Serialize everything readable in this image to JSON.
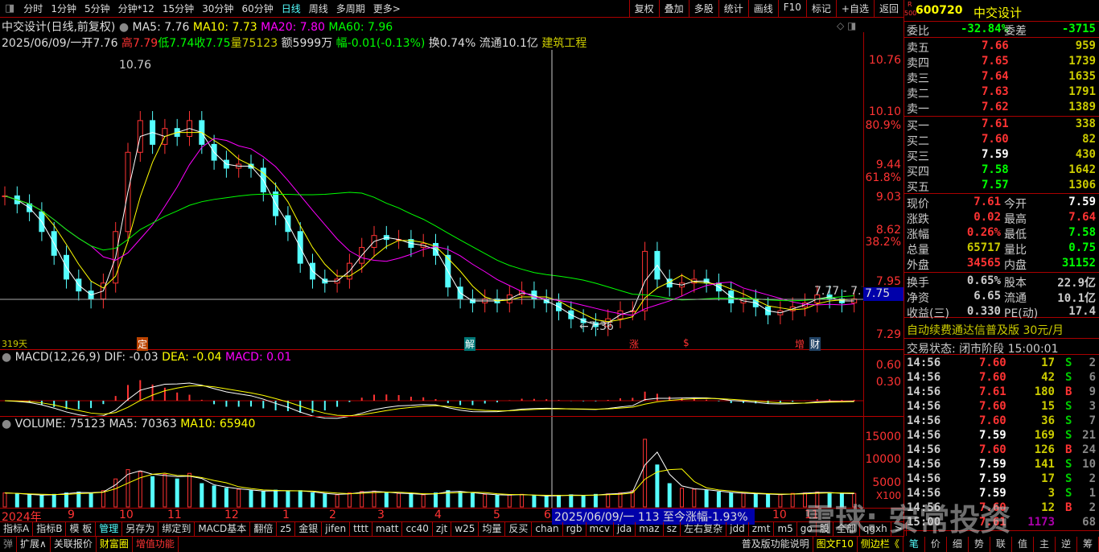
{
  "toolbar": {
    "periods": [
      "分时",
      "1分钟",
      "5分钟",
      "分钟*12",
      "15分钟",
      "30分钟",
      "60分钟",
      "日线",
      "周线",
      "多周期",
      "更多>"
    ],
    "active": "日线",
    "right": [
      "复权",
      "叠加",
      "多股",
      "统计",
      "画线",
      "F10",
      "标记",
      "+自选",
      "返回"
    ]
  },
  "header": {
    "title": "中交设计(日线,前复权)",
    "ma5": "MA5: 7.76",
    "ma10": "MA10: 7.73",
    "ma20": "MA20: 7.80",
    "ma60": "MA60: 7.96",
    "date": "2025/06/09/一",
    "open": "开7.76",
    "high": "高7.79",
    "low": "低7.74",
    "close": "收7.75",
    "vol": "量75123",
    "amt": "额5999万",
    "chg": "幅-0.01(-0.13%)",
    "turn": "换0.74%",
    "float": "流通10.1亿",
    "sector": "建筑工程"
  },
  "price_axis": [
    "10.76",
    "10.10",
    "80.9%",
    "9.44",
    "61.8%",
    "9.03",
    "8.62",
    "38.2%",
    "7.95",
    "7.29"
  ],
  "current_price_tag": "7.75",
  "annotations": {
    "high": "10.76",
    "low": "←7.36",
    "range": "7.77 - 7.7",
    "days": "319天"
  },
  "markers": [
    "定",
    "解",
    "涨",
    "$",
    "增",
    "财"
  ],
  "macd": {
    "title": "MACD(12,26,9)",
    "dif": "DIF: -0.03",
    "dea": "DEA: -0.04",
    "macd": "MACD: 0.01",
    "axis": [
      "0.60",
      "0.30"
    ]
  },
  "volume": {
    "title": "VOLUME: 75123",
    "ma5": "MA5: 70363",
    "ma10": "MA10: 65940",
    "axis": [
      "15000",
      "10000",
      "5000",
      "X100"
    ]
  },
  "chart_data": {
    "type": "candlestick",
    "closes": [
      9.05,
      8.95,
      8.85,
      8.6,
      8.3,
      8.0,
      7.85,
      7.75,
      7.95,
      8.6,
      9.6,
      10.0,
      9.7,
      9.9,
      9.8,
      10.0,
      9.7,
      9.5,
      9.4,
      9.45,
      9.4,
      9.1,
      8.8,
      8.6,
      8.2,
      8.0,
      7.95,
      8.0,
      8.2,
      8.4,
      8.55,
      8.5,
      8.5,
      8.4,
      8.45,
      8.3,
      7.9,
      7.75,
      7.7,
      7.75,
      7.7,
      7.8,
      7.85,
      7.75,
      7.7,
      7.6,
      7.5,
      7.45,
      7.4,
      7.5,
      7.6,
      7.6,
      8.35,
      8.0,
      7.9,
      7.95,
      8.0,
      7.95,
      7.85,
      7.7,
      7.75,
      7.65,
      7.55,
      7.6,
      7.65,
      7.7,
      7.8,
      7.75,
      7.7,
      7.75
    ],
    "volumes": [
      3000,
      2800,
      2600,
      2500,
      2700,
      3000,
      3200,
      2900,
      3500,
      6000,
      8000,
      7500,
      6500,
      7000,
      6000,
      7200,
      5000,
      4500,
      4000,
      3800,
      3500,
      3300,
      3600,
      3400,
      3500,
      3000,
      2800,
      2600,
      3000,
      3300,
      3400,
      3000,
      2900,
      2800,
      2600,
      3000,
      3500,
      3200,
      2900,
      2700,
      2500,
      2600,
      2700,
      2400,
      2300,
      2500,
      2600,
      2400,
      2700,
      2800,
      3000,
      3500,
      14500,
      9000,
      5000,
      4000,
      3800,
      3600,
      3200,
      3000,
      2900,
      2800,
      2700,
      2600,
      2900,
      3000,
      3200,
      3000,
      2800,
      2900
    ]
  },
  "dates": {
    "labels": [
      "2024年",
      "9",
      "10",
      "11",
      "12",
      "1",
      "2",
      "3",
      "4",
      "5",
      "6",
      "10",
      "11"
    ],
    "cursor": "2025/06/09/一  113  至今涨幅-1.93%"
  },
  "buttons": [
    "指标A",
    "指标B",
    "模 板",
    "管理",
    "另存为",
    "绑定到",
    "MACD基本",
    "翻倍",
    "z5",
    "金银",
    "jifen",
    "tttt",
    "matt",
    "cc40",
    "zjt",
    "w25",
    "均量",
    "反买",
    "chan",
    "rgb",
    "mcv",
    "jda",
    "maz",
    "sz",
    "左右复杂",
    "jdd",
    "zmt",
    "m5",
    "go",
    "股",
    "全部",
    "qgxh",
    ">"
  ],
  "bottom": {
    "left": [
      "弹",
      "扩展∧",
      "关联报价",
      "财富圈",
      "增值功能"
    ],
    "right": [
      "普及版功能说明",
      "图文F10",
      "侧边栏《"
    ],
    "tabs": [
      "笔",
      "价",
      "细",
      "势",
      "联",
      "值",
      "主",
      "逆",
      "筹"
    ]
  },
  "quote": {
    "badge_top": "R",
    "badge_bot": "500",
    "code": "600720",
    "name": "中交设计",
    "weibi_l": "委比",
    "weibi": "-32.84%",
    "weicha_l": "委差",
    "weicha": "-3715",
    "asks": [
      {
        "l": "卖五",
        "p": "7.66",
        "v": "959"
      },
      {
        "l": "卖四",
        "p": "7.65",
        "v": "1739"
      },
      {
        "l": "卖三",
        "p": "7.64",
        "v": "1635"
      },
      {
        "l": "卖二",
        "p": "7.63",
        "v": "1791"
      },
      {
        "l": "卖一",
        "p": "7.62",
        "v": "1389"
      }
    ],
    "bids": [
      {
        "l": "买一",
        "p": "7.61",
        "v": "338",
        "c": "#f33"
      },
      {
        "l": "买二",
        "p": "7.60",
        "v": "82",
        "c": "#f33"
      },
      {
        "l": "买三",
        "p": "7.59",
        "v": "430",
        "c": "#fff"
      },
      {
        "l": "买四",
        "p": "7.58",
        "v": "1642",
        "c": "#0f0"
      },
      {
        "l": "买五",
        "p": "7.57",
        "v": "1306",
        "c": "#0f0"
      }
    ],
    "stats": [
      {
        "l1": "现价",
        "v1": "7.61",
        "c1": "#f33",
        "l2": "今开",
        "v2": "7.59",
        "c2": "#fff"
      },
      {
        "l1": "涨跌",
        "v1": "0.02",
        "c1": "#f33",
        "l2": "最高",
        "v2": "7.64",
        "c2": "#f33"
      },
      {
        "l1": "涨幅",
        "v1": "0.26%",
        "c1": "#f33",
        "l2": "最低",
        "v2": "7.58",
        "c2": "#0f0"
      },
      {
        "l1": "总量",
        "v1": "65717",
        "c1": "#cc0",
        "l2": "量比",
        "v2": "0.75",
        "c2": "#0f0"
      },
      {
        "l1": "外盘",
        "v1": "34565",
        "c1": "#f33",
        "l2": "内盘",
        "v2": "31152",
        "c2": "#0f0"
      }
    ],
    "fin": [
      {
        "l1": "换手",
        "v1": "0.65%",
        "l2": "股本",
        "v2": "22.9亿"
      },
      {
        "l1": "净资",
        "v1": "6.65",
        "l2": "流通",
        "v2": "10.1亿"
      },
      {
        "l1": "收益(三)",
        "v1": "0.330",
        "l2": "PE(动)",
        "v2": "17.4"
      }
    ],
    "promo": "自动续费通达信普及版  30元/月",
    "status": "交易状态: 闭市阶段 15:00:01",
    "ticks": [
      [
        "14:56",
        "7.60",
        "17",
        "S",
        "2"
      ],
      [
        "14:56",
        "7.60",
        "42",
        "S",
        "6"
      ],
      [
        "14:56",
        "7.61",
        "180",
        "B",
        "9"
      ],
      [
        "14:56",
        "7.60",
        "15",
        "S",
        "3"
      ],
      [
        "14:56",
        "7.60",
        "36",
        "S",
        "7"
      ],
      [
        "14:56",
        "7.59",
        "169",
        "S",
        "21"
      ],
      [
        "14:56",
        "7.60",
        "126",
        "B",
        "24"
      ],
      [
        "14:56",
        "7.59",
        "141",
        "S",
        "10"
      ],
      [
        "14:56",
        "7.59",
        "17",
        "S",
        "2"
      ],
      [
        "14:56",
        "7.59",
        "3",
        "S",
        "1"
      ],
      [
        "14:56",
        "7.60",
        "12",
        "B",
        "2"
      ],
      [
        "15:00",
        "7.61",
        "1173",
        "",
        "68"
      ]
    ]
  },
  "watermark": "雪球: 安常投资"
}
